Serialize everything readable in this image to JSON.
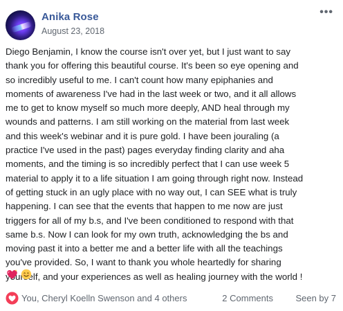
{
  "post": {
    "author": "Anika Rose",
    "date": "August 23, 2018",
    "more_icon": "more-options-icon",
    "body_lines": [
      "Diego Benjamin, I know the course isn't over yet, but I just want to say",
      "thank you for offering this beautiful course. It's been so eye opening and",
      "so incredibly useful to me. I can't count how many epiphanies and",
      "moments of awareness I've had in the last week or two, and it all allows",
      "me to get to know myself so much more deeply, AND heal through my",
      "wounds and patterns. I am still working on the material from last week",
      "and this week's webinar and it is pure gold. I have been jouraling (a",
      "practice I've used in the past) pages everyday finding clarity and aha",
      "moments, and the timing is so incredibly perfect that I can use week 5",
      "material to apply it to a life situation I am going through right now. Instead",
      "of getting stuck in an ugly place with no way out, I can SEE what is truly",
      "happening. I can see that the events that happen to me now are just",
      "triggers for all of my b.s, and I've been conditioned to respond with that",
      "same b.s. Now I can look for my own truth, acknowledging the bs and",
      "moving past it into a better me and a better life with all the teachings",
      "you've provided. So, I want to thank you whole heartedly for sharing",
      "yourself, and your experiences as well as healing journey with the world !"
    ],
    "emojis": [
      "sparkling-heart-emoji",
      "smiling-face-emoji"
    ]
  },
  "footer": {
    "reaction_icon": "love-reaction-icon",
    "reactors": "You, Cheryl Koelln Swenson and 4 others",
    "comments": "2 Comments",
    "seen": "Seen by 7"
  },
  "colors": {
    "author": "#385898",
    "meta": "#606770",
    "text": "#1c1e21",
    "love": "#f33e58"
  }
}
